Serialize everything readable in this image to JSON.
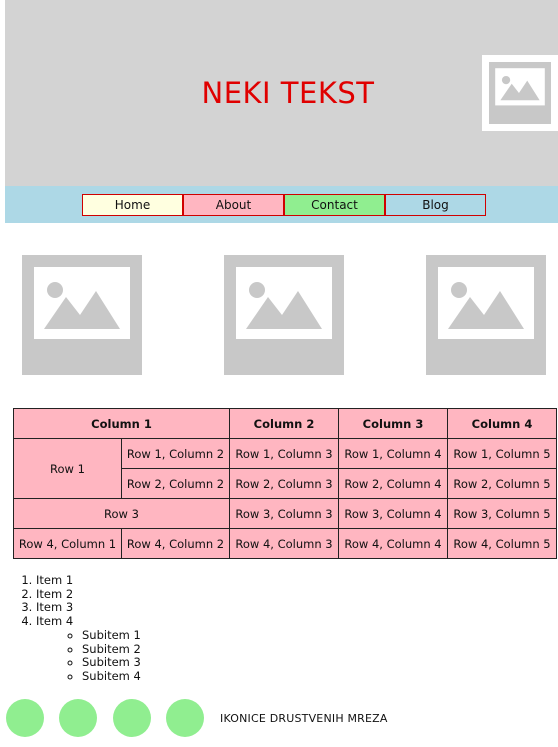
{
  "header": {
    "title": "NEKI TEKST",
    "title_color": "#e00000",
    "background": "#d3d3d3",
    "logo_icon": "image-placeholder-icon"
  },
  "nav": {
    "background": "#add8e6",
    "items": [
      {
        "label": "Home",
        "color": "#ffffe0"
      },
      {
        "label": "About",
        "color": "#ffb6c1"
      },
      {
        "label": "Contact",
        "color": "#90ee90"
      },
      {
        "label": "Blog",
        "color": "#add8e6"
      }
    ]
  },
  "gallery": {
    "icons": [
      "image-placeholder-icon",
      "image-placeholder-icon",
      "image-placeholder-icon"
    ]
  },
  "table": {
    "background": "#ffb6c1",
    "headers": [
      "Column 1",
      "Column 2",
      "Column 3",
      "Column 4"
    ],
    "row1_label": "Row 1",
    "row1": [
      "Row 1, Column 2",
      "Row 1, Column 3",
      "Row 1, Column 4",
      "Row 1, Column 5"
    ],
    "row2": [
      "Row 2, Column 2",
      "Row 2, Column 3",
      "Row 2, Column 4",
      "Row 2, Column 5"
    ],
    "row3_label": "Row 3",
    "row3": [
      "Row 3, Column 3",
      "Row 3, Column 4",
      "Row 3, Column 5"
    ],
    "row4": [
      "Row 4, Column 1",
      "Row 4, Column 2",
      "Row 4, Column 3",
      "Row 4, Column 4",
      "Row 4, Column 5"
    ]
  },
  "list": {
    "items": [
      "Item 1",
      "Item 2",
      "Item 3",
      "Item 4"
    ],
    "subitems": [
      "Subitem 1",
      "Subitem 2",
      "Subitem 3",
      "Subitem 4"
    ]
  },
  "social": {
    "label": "IKONICE DRUSTVENIH MREZA",
    "icon_color": "#90ee90",
    "icons": [
      "social-icon-1",
      "social-icon-2",
      "social-icon-3",
      "social-icon-4"
    ]
  }
}
